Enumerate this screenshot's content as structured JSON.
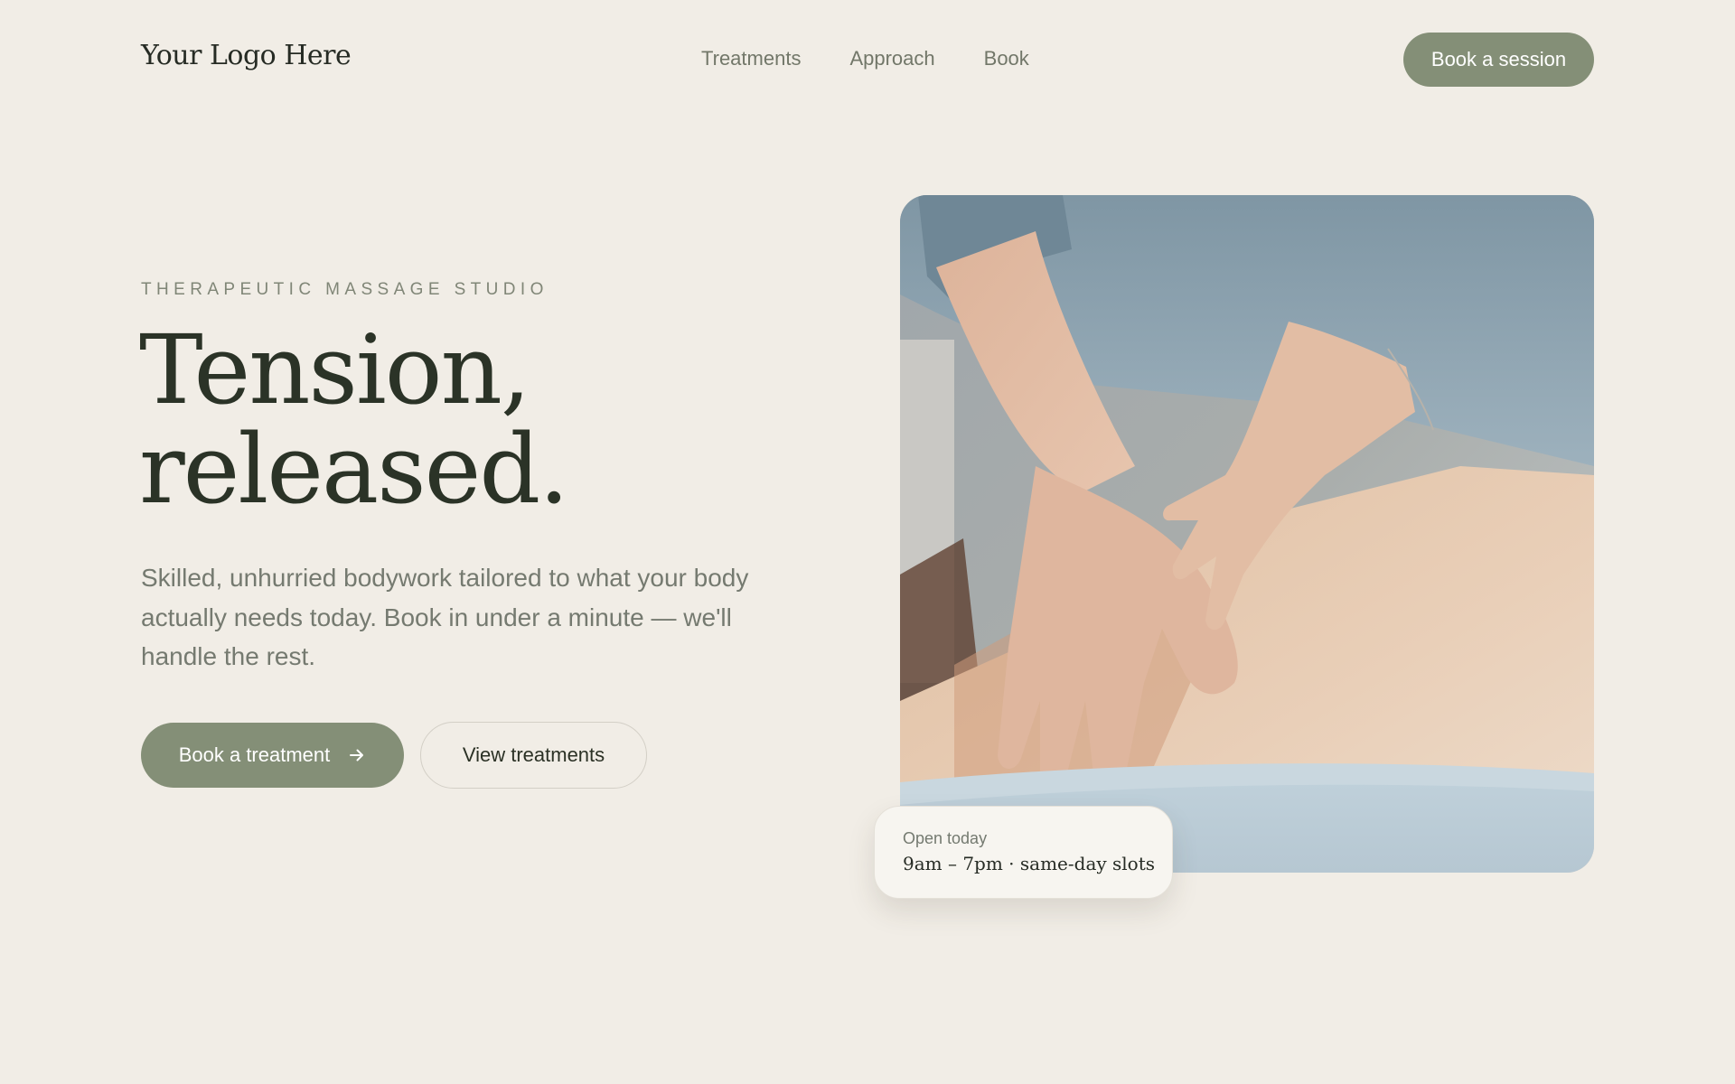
{
  "header": {
    "logo": "Your Logo Here",
    "nav": [
      {
        "label": "Treatments"
      },
      {
        "label": "Approach"
      },
      {
        "label": "Book"
      }
    ],
    "cta_label": "Book a session"
  },
  "hero": {
    "eyebrow": "THERAPEUTIC MASSAGE STUDIO",
    "headline_line1": "Tension,",
    "headline_line2": "released.",
    "lede": "Skilled, unhurried bodywork tailored to what your body actually needs today. Book in under a minute — we'll handle the rest.",
    "primary_cta": {
      "label": "Book a treatment",
      "icon": "arrow-right-icon"
    },
    "secondary_cta": {
      "label": "View treatments"
    },
    "image": {
      "subject": "massage-photo"
    }
  },
  "hours_card": {
    "label": "Open today",
    "value": "9am – 7pm · same-day slots"
  },
  "colors": {
    "background": "#f1ede6",
    "accent": "#848f77",
    "heading": "#2b3327",
    "body_text": "#757a70",
    "card": "#f7f5f0"
  }
}
